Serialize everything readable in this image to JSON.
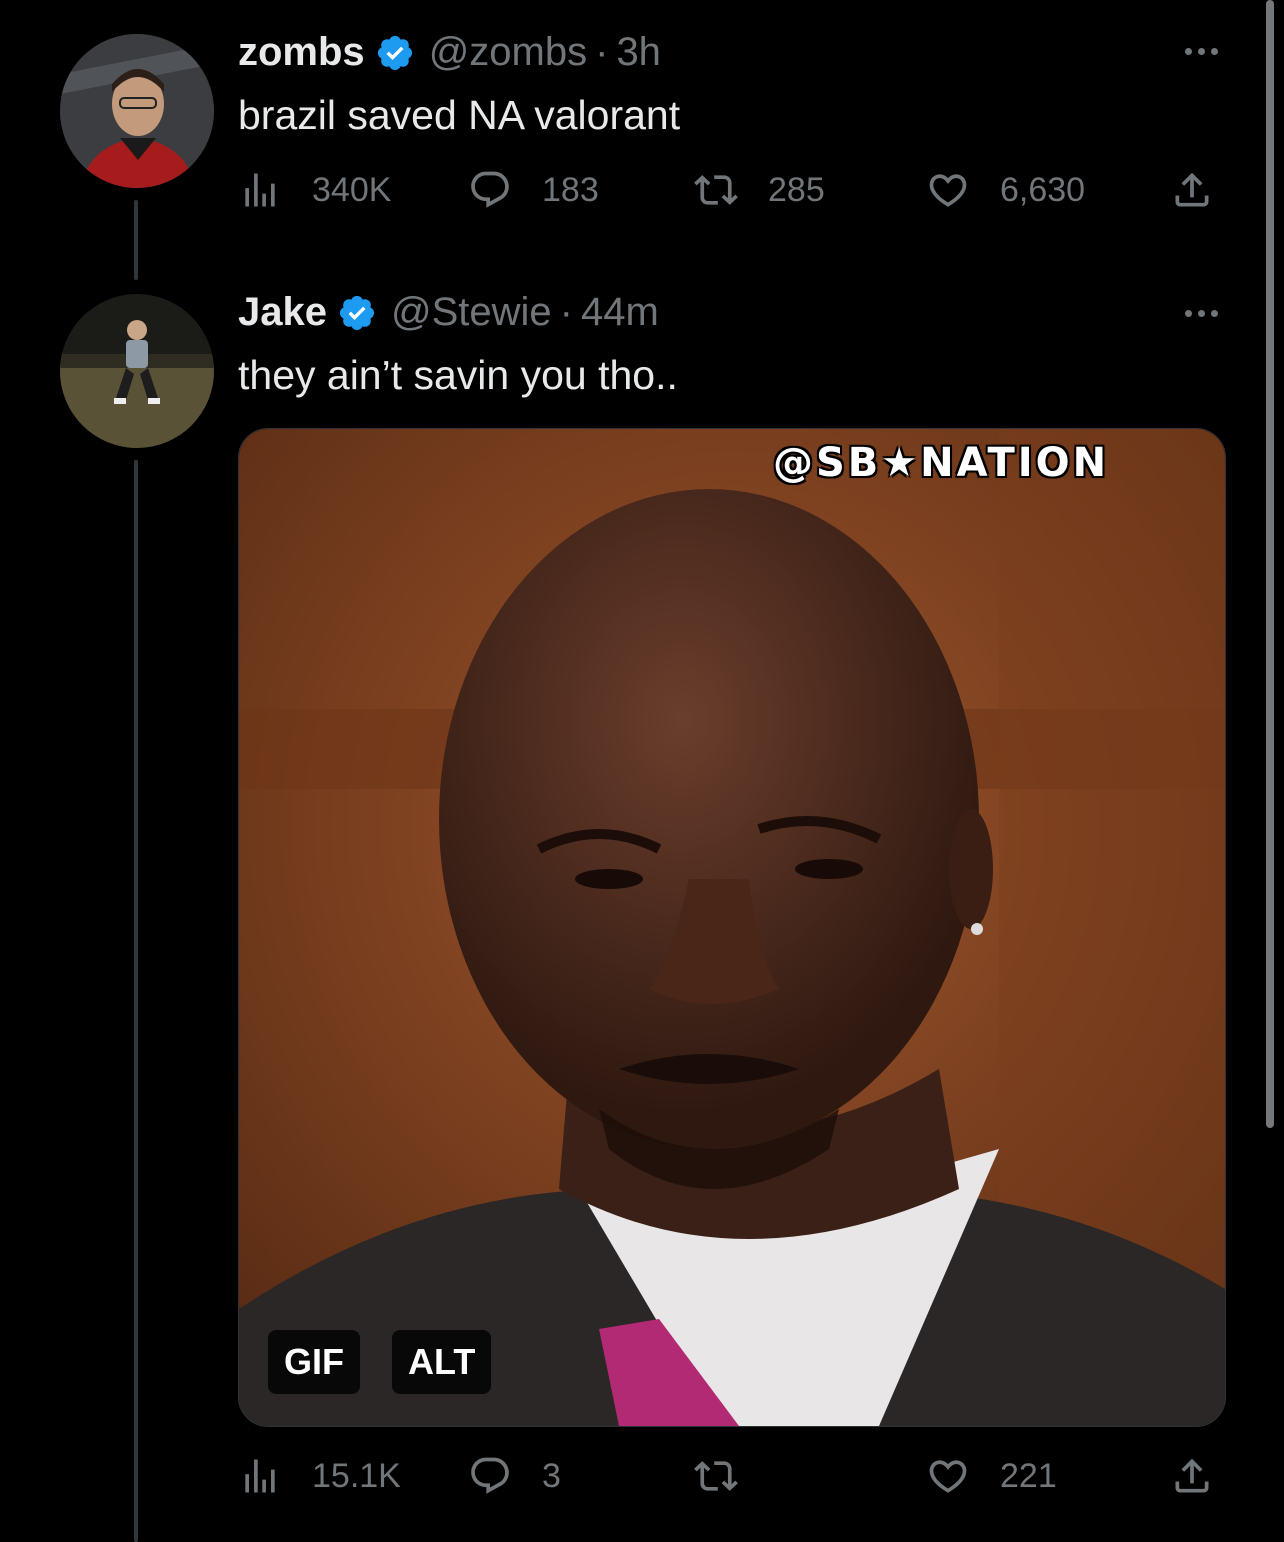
{
  "tweets": [
    {
      "name": "zombs",
      "handle": "@zombs",
      "separator": "·",
      "time": "3h",
      "text": "brazil saved NA valorant",
      "stats": {
        "views": "340K",
        "replies": "183",
        "retweets": "285",
        "likes": "6,630"
      }
    },
    {
      "name": "Jake",
      "handle": "@Stewie",
      "separator": "·",
      "time": "44m",
      "text": "they ain’t savin you tho..",
      "stats": {
        "views": "15.1K",
        "replies": "3",
        "retweets": "",
        "likes": "221"
      },
      "media": {
        "gif_badge": "GIF",
        "alt_badge": "ALT",
        "watermark": "@SB★NATION"
      }
    }
  ],
  "colors": {
    "background": "#000000",
    "text": "#e7e9ea",
    "muted": "#71767b",
    "verified": "#1d9bf0"
  },
  "icons": [
    "verified-badge-icon",
    "more-icon",
    "views-icon",
    "reply-icon",
    "retweet-icon",
    "like-icon",
    "share-icon"
  ]
}
